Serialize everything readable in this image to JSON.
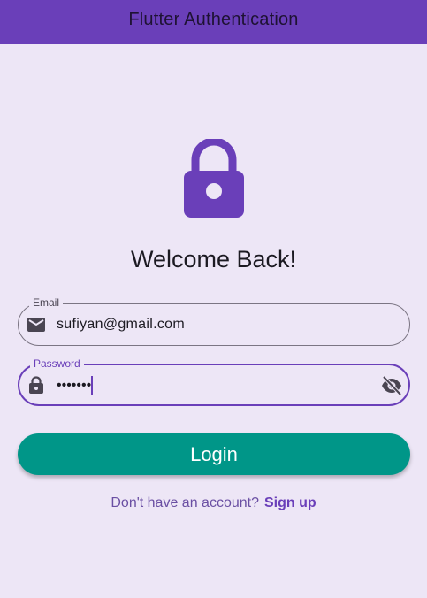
{
  "appbar": {
    "title": "Flutter Authentication",
    "background": "#6a3fb9"
  },
  "hero": {
    "icon": "lock-icon",
    "color": "#6a3fb9"
  },
  "heading": "Welcome Back!",
  "email_field": {
    "label": "Email",
    "value": "sufiyan@gmail.com",
    "icon": "mail-icon"
  },
  "password_field": {
    "label": "Password",
    "masked_value": "•••••••",
    "icon": "lock-icon",
    "toggle_icon": "visibility-off-icon"
  },
  "login_button": {
    "label": "Login",
    "color": "#009688"
  },
  "signup": {
    "prompt": "Don't have an account?",
    "link": "Sign up"
  }
}
